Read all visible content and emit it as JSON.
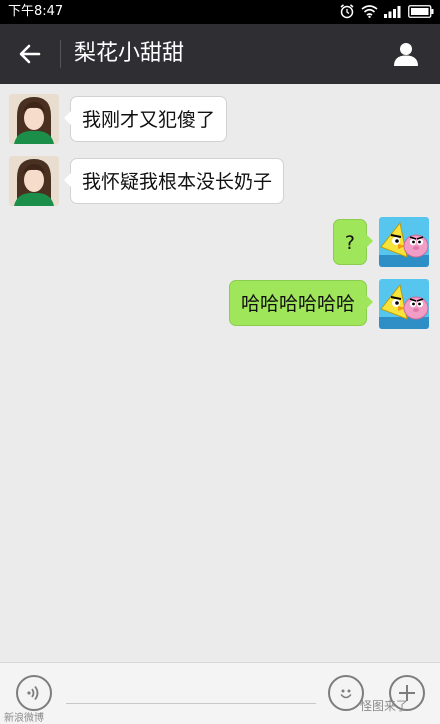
{
  "status_bar": {
    "time": "下午8:47"
  },
  "header": {
    "title": "梨花小甜甜"
  },
  "messages": [
    {
      "side": "left",
      "text": "我刚才又犯傻了"
    },
    {
      "side": "left",
      "text": "我怀疑我根本没长奶子"
    },
    {
      "side": "right",
      "text": "?"
    },
    {
      "side": "right",
      "text": "哈哈哈哈哈哈"
    }
  ],
  "input_bar": {
    "icons": [
      "voice-icon",
      "emoji-icon",
      "plus-icon"
    ]
  },
  "watermark": {
    "right": "怪图来了",
    "left": "新浪微博"
  },
  "colors": {
    "header_bg": "#2f2f33",
    "chat_bg": "#ebebeb",
    "sent_bubble": "#a0e65b",
    "received_bubble": "#ffffff"
  }
}
